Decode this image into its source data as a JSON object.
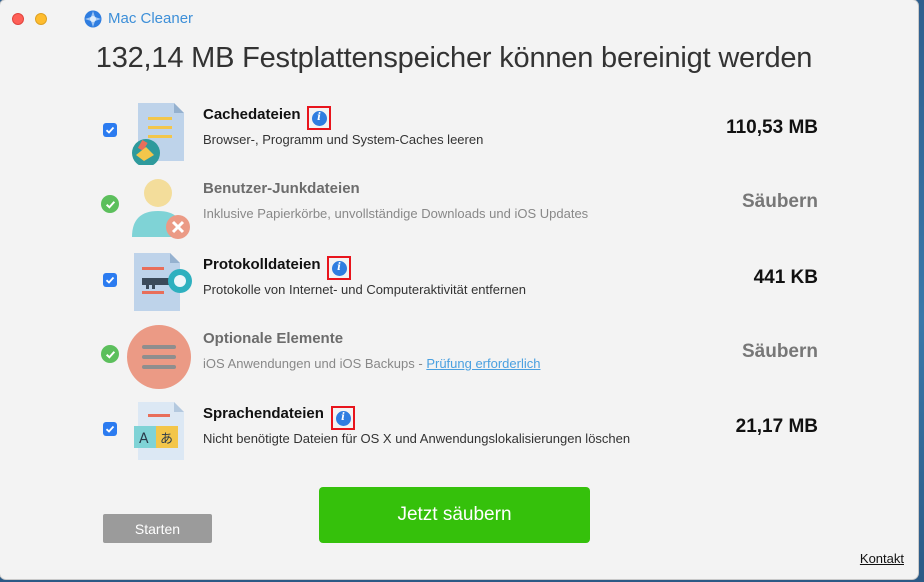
{
  "app": {
    "title": "Mac Cleaner"
  },
  "headline": "132,14 MB Festplattenspeicher können bereinigt werden",
  "rows": [
    {
      "title": "Cachedateien",
      "description": "Browser-, Programm und System-Caches leeren",
      "size": "110,53 MB",
      "state": "checked",
      "icon": "cache-files-icon"
    },
    {
      "title": "Benutzer-Junkdateien",
      "description": "Inklusive Papierkörbe, unvollständige Downloads und iOS Updates",
      "size": "Säubern",
      "state": "done",
      "icon": "user-junk-icon"
    },
    {
      "title": "Protokolldateien",
      "description": "Protokolle von Internet- und Computeraktivität entfernen",
      "size": "441 KB",
      "state": "checked",
      "icon": "log-files-icon"
    },
    {
      "title": "Optionale Elemente",
      "description": "iOS Anwendungen und iOS Backups - ",
      "link": "Prüfung erforderlich",
      "size": "Säubern",
      "state": "done",
      "icon": "optional-items-icon"
    },
    {
      "title": "Sprachendateien",
      "description": "Nicht benötigte Dateien für OS X und Anwendungslokalisierungen löschen",
      "size": "21,17 MB",
      "state": "checked",
      "icon": "language-files-icon"
    }
  ],
  "buttons": {
    "start": "Starten",
    "clean": "Jetzt säubern",
    "contact": "Kontakt"
  },
  "colors": {
    "accent_green": "#35c10b",
    "checkbox_blue": "#2b7bf0",
    "highlight_red": "#e8141c",
    "title_blue": "#3d8fd8"
  }
}
